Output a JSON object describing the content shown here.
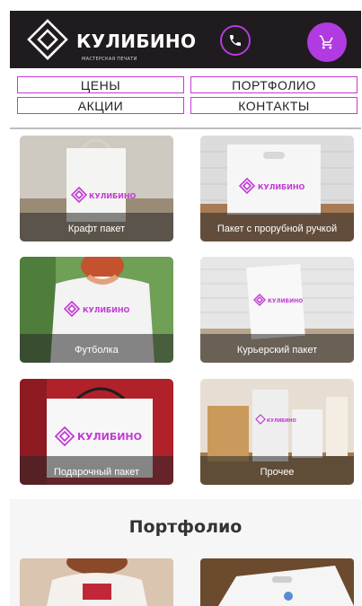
{
  "header": {
    "brand_name": "КУЛИБИНО",
    "brand_tagline": "МАСТЕРСКАЯ ПЕЧАТИ",
    "phone_icon": "phone-icon",
    "cart_icon": "cart-icon",
    "accent_color": "#b13ae0"
  },
  "nav": {
    "prices": "ЦЕНЫ",
    "portfolio": "ПОРТФОЛИО",
    "promotions": "АКЦИИ",
    "contacts": "КОНТАКТЫ"
  },
  "products": [
    {
      "label": "Крафт пакет",
      "print": "КУЛИБИНО"
    },
    {
      "label": "Пакет с прорубной ручкой",
      "print": "КУЛИБИНО"
    },
    {
      "label": "Футболка",
      "print": "КУЛИБИНО"
    },
    {
      "label": "Курьерский пакет",
      "print": "КУЛИБИНО"
    },
    {
      "label": "Подарочный пакет",
      "print": "КУЛИБИНО"
    },
    {
      "label": "Прочее",
      "print": "КУЛИБИНО"
    }
  ],
  "portfolio": {
    "title": "Портфолио"
  }
}
